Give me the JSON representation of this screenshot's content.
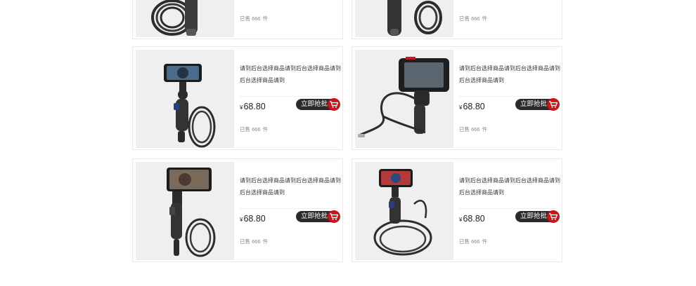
{
  "products": [
    {
      "title": "",
      "currency": "",
      "price": "",
      "buy_label": "",
      "sold_prefix": "已售",
      "sold_count": "666",
      "sold_unit": "件",
      "icon": "cart-icon"
    },
    {
      "title": "",
      "currency": "",
      "price": "",
      "buy_label": "",
      "sold_prefix": "已售",
      "sold_count": "666",
      "sold_unit": "件",
      "icon": "cart-icon"
    },
    {
      "title": "请到后台选择商品请到后台选择商品请到后台选择商品请到",
      "currency": "¥",
      "price": "68.80",
      "buy_label": "立即抢批",
      "sold_prefix": "已售",
      "sold_count": "666",
      "sold_unit": "件",
      "icon": "cart-icon"
    },
    {
      "title": "请到后台选择商品请到后台选择商品请到后台选择商品请到",
      "currency": "¥",
      "price": "68.80",
      "buy_label": "立即抢批",
      "sold_prefix": "已售",
      "sold_count": "666",
      "sold_unit": "件",
      "icon": "cart-icon"
    },
    {
      "title": "请到后台选择商品请到后台选择商品请到后台选择商品请到",
      "currency": "¥",
      "price": "68.80",
      "buy_label": "立即抢批",
      "sold_prefix": "已售",
      "sold_count": "666",
      "sold_unit": "件",
      "icon": "cart-icon"
    },
    {
      "title": "请到后台选择商品请到后台选择商品请到后台选择商品请到",
      "currency": "¥",
      "price": "68.80",
      "buy_label": "立即抢批",
      "sold_prefix": "已售",
      "sold_count": "666",
      "sold_unit": "件",
      "icon": "cart-icon"
    }
  ],
  "colors": {
    "accent": "#c8161d",
    "button": "#2a2a2a",
    "thumb_bg": "#efefef",
    "border": "#e9e9e9"
  }
}
